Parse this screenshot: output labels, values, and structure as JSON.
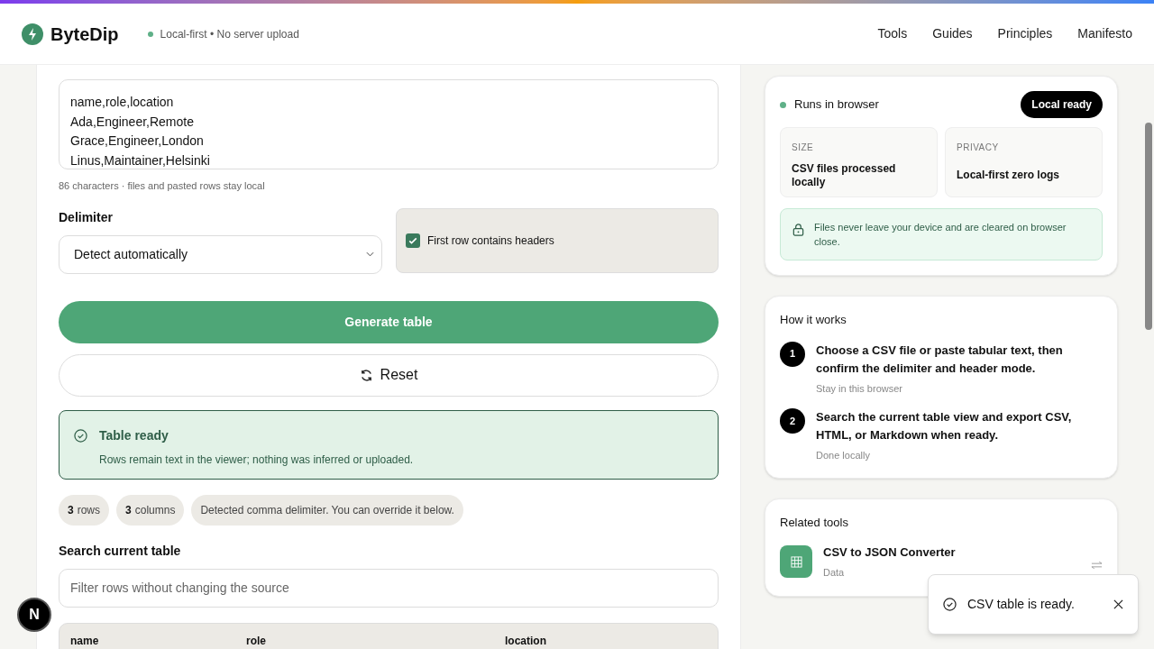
{
  "header": {
    "brand": "ByteDip",
    "status": "Local-first • No server upload",
    "nav": [
      {
        "label": "Tools"
      },
      {
        "label": "Guides"
      },
      {
        "label": "Principles"
      },
      {
        "label": "Manifesto"
      }
    ]
  },
  "editor": {
    "csv_text": "name,role,location\nAda,Engineer,Remote\nGrace,Engineer,London\nLinus,Maintainer,Helsinki",
    "hint": "86 characters · files and pasted rows stay local",
    "delimiter_label": "Delimiter",
    "delimiter_value": "Detect automatically",
    "headers_checkbox": {
      "label": "First row contains headers",
      "checked": true
    },
    "generate_button": "Generate table",
    "reset_button": "Reset"
  },
  "alert": {
    "title": "Table ready",
    "message": "Rows remain text in the viewer; nothing was inferred or uploaded."
  },
  "chips": [
    {
      "count": "3",
      "label": "rows"
    },
    {
      "count": "3",
      "label": "columns"
    },
    {
      "label": "Detected comma delimiter. You can override it below."
    }
  ],
  "search": {
    "label": "Search current table",
    "placeholder": "Filter rows without changing the source"
  },
  "table": {
    "columns": [
      "name",
      "role",
      "location"
    ]
  },
  "status_card": {
    "title": "Runs in browser",
    "badge": "Local ready",
    "stats": [
      {
        "label": "SIZE",
        "value": "CSV files processed locally"
      },
      {
        "label": "PRIVACY",
        "value": "Local-first zero logs"
      }
    ],
    "notice": "Files never leave your device and are cleared on browser close."
  },
  "how_it_works": {
    "title": "How it works",
    "steps": [
      {
        "number": "1",
        "text": "Choose a CSV file or paste tabular text, then confirm the delimiter and header mode.",
        "note": "Stay in this browser"
      },
      {
        "number": "2",
        "text": "Search the current table view and export CSV, HTML, or Markdown when ready.",
        "note": "Done locally"
      }
    ]
  },
  "related_tools": {
    "title": "Related tools",
    "items": [
      {
        "name": "CSV to JSON Converter",
        "category": "Data"
      }
    ]
  },
  "toast": {
    "message": "CSV table is ready."
  },
  "dev_badge": "N"
}
